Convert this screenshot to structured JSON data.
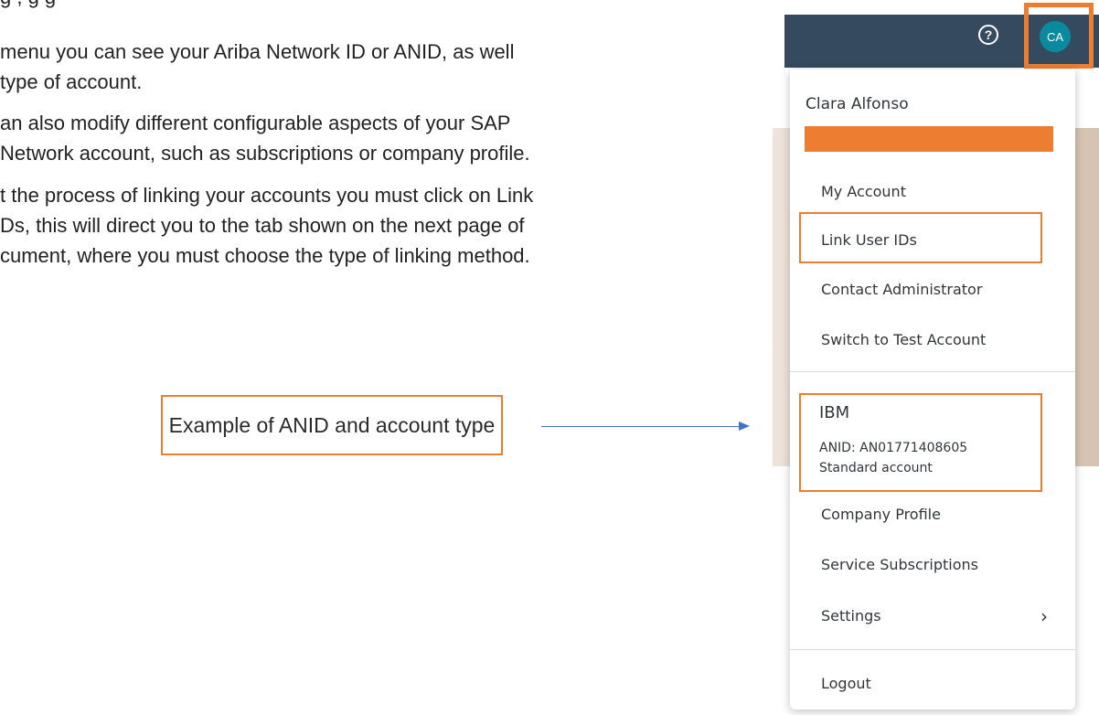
{
  "document": {
    "paragraphs": [
      [
        "                      g   ,                                 g  g"
      ],
      [
        "menu you can see your Ariba Network ID or ANID, as well",
        "type of account."
      ],
      [
        "an also modify different configurable aspects of your SAP",
        "Network account, such as subscriptions or company profile."
      ],
      [
        "t the process of linking your accounts you must click on Link",
        "Ds, this will direct you to the tab shown on the next page of",
        "cument, where you must choose the type of linking method."
      ]
    ],
    "callout": "Example of ANID and account type"
  },
  "topbar": {
    "help_icon": "?",
    "avatar_initials": "CA"
  },
  "menu": {
    "user_name": "Clara Alfonso",
    "items_top": [
      "My Account",
      "Link User IDs",
      "Contact Administrator",
      "Switch to Test Account"
    ],
    "company": {
      "name": "IBM",
      "anid": "ANID: AN01771408605",
      "account_type": "Standard account"
    },
    "items_bottom": [
      "Company Profile",
      "Service Subscriptions",
      "Settings"
    ],
    "settings_chevron": "›",
    "logout": "Logout"
  },
  "colors": {
    "highlight": "#ED7D31",
    "arrow": "#4472C4",
    "topbar": "#354a5f",
    "avatar": "#0a8a9e"
  }
}
